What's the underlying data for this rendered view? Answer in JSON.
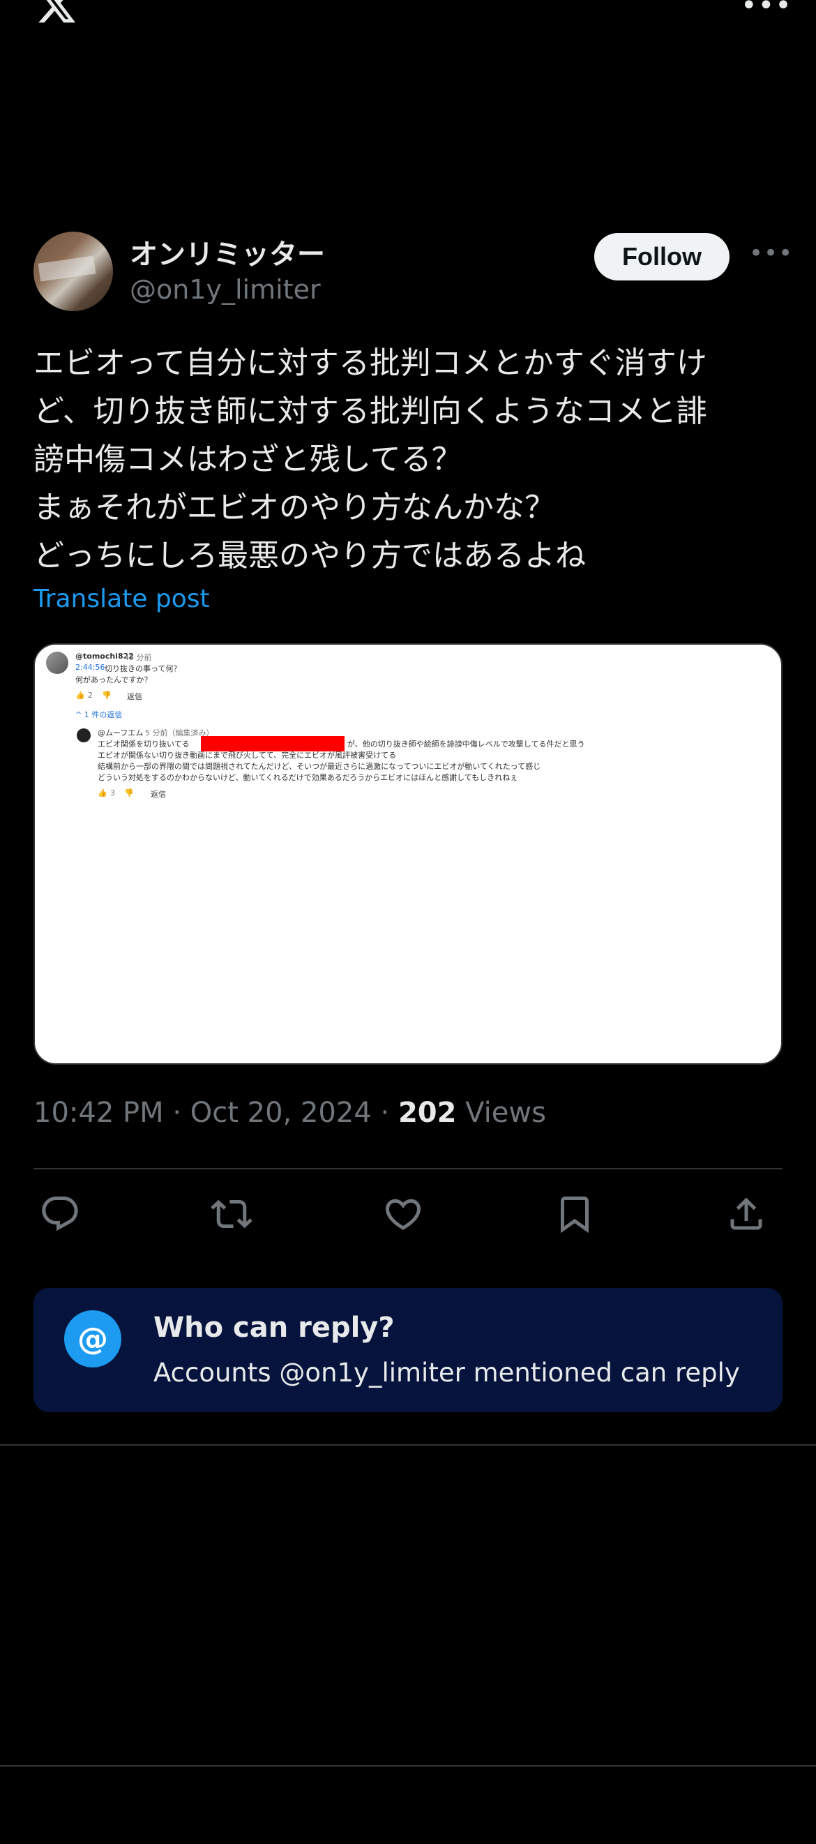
{
  "topbar": {
    "more_label": "•••"
  },
  "user": {
    "display_name": "オンリミッター",
    "handle": "@on1y_limiter",
    "follow_label": "Follow",
    "more_label": "•••"
  },
  "tweet": {
    "lines": [
      "エビオって自分に対する批判コメとかすぐ消すけ",
      "ど、切り抜き師に対する批判向くようなコメと誹",
      "謗中傷コメはわざと残してる？",
      "まぁそれがエビオのやり方なんかな？",
      "どっちにしろ最悪のやり方ではあるよね"
    ],
    "translate_label": "Translate post"
  },
  "media": {
    "comment1_author": "@tomochi822",
    "comment1_time": "45 分前",
    "comment1_timestamp": "2:44:56",
    "comment1_text_a": "切り抜きの事って何？",
    "comment1_text_b": "何があったんですか？",
    "comment1_likes": "2",
    "reply_label": "返信",
    "replies_toggle": "^  1 件の返信",
    "comment2_author": "@ムーフエム",
    "comment2_time": "5 分前（編集済み）",
    "comment2_line1_a": "エビオ関係を切り抜いてる",
    "comment2_line1_b": "が、他の切り抜き師や絵師を誹謗中傷レベルで攻撃してる件だと思う",
    "comment2_line2": "エビオが関係ない切り抜き動画にまで飛び火してて、完全にエビオが風評被害受けてる",
    "comment2_line3": "結構前から一部の界隈の間では問題視されてたんだけど、そいつが最近さらに過激になってついにエビオが動いてくれたって感じ",
    "comment2_line4": "どういう対処をするのかわからないけど、動いてくれるだけで効果あるだろうからエビオにはほんと感謝してもしきれねぇ",
    "comment2_likes": "3"
  },
  "meta": {
    "time": "10:42 PM",
    "date": "Oct 20, 2024",
    "separator": " · ",
    "views_count": "202",
    "views_label": " Views"
  },
  "actions": [
    {
      "name": "reply-icon"
    },
    {
      "name": "repost-icon"
    },
    {
      "name": "like-icon"
    },
    {
      "name": "bookmark-icon"
    },
    {
      "name": "share-icon"
    }
  ],
  "who_can_reply": {
    "icon_glyph": "@",
    "title": "Who can reply?",
    "subtitle": "Accounts @on1y_limiter mentioned can reply"
  },
  "colors": {
    "background": "#000000",
    "text": "#e7e9ea",
    "secondary": "#71767b",
    "accent": "#1d9bf0",
    "reply_box": "#06143d"
  }
}
